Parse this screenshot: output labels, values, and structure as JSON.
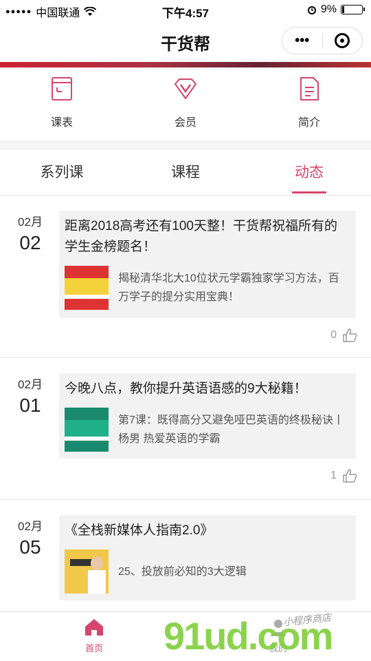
{
  "status_bar": {
    "signal": "●●●●●",
    "carrier": "中国联通",
    "wifi": "wifi-icon",
    "time": "下午4:57",
    "battery": "9%"
  },
  "nav": {
    "title": "干货帮",
    "more": "•••"
  },
  "quick_menu": [
    {
      "label": "课表",
      "icon": "schedule-icon"
    },
    {
      "label": "会员",
      "icon": "vip-icon"
    },
    {
      "label": "简介",
      "icon": "document-icon"
    }
  ],
  "tabs": [
    {
      "label": "系列课",
      "active": false
    },
    {
      "label": "课程",
      "active": false
    },
    {
      "label": "动态",
      "active": true
    }
  ],
  "posts": [
    {
      "month": "02月",
      "day": "02",
      "title": "距离2018高考还有100天整！干货帮祝福所有的学生金榜题名！",
      "attach_text": "揭秘清华北大10位状元学霸独家学习方法，百万学子的提分实用宝典！",
      "likes": "0"
    },
    {
      "month": "02月",
      "day": "01",
      "title": "今晚八点，教你提升英语语感的9大秘籍！",
      "attach_text": "第7课：既得高分又避免哑巴英语的终极秘诀丨杨男 热爱英语的学霸",
      "likes": "1"
    },
    {
      "month": "02月",
      "day": "05",
      "title": "《全栈新媒体人指南2.0》",
      "attach_text": "25、投放前必知的3大逻辑",
      "likes": ""
    }
  ],
  "tabbar": {
    "home": "首页",
    "mine": "我的"
  },
  "watermark": {
    "main": "91ud.com",
    "sub": "小程序商店"
  },
  "colors": {
    "accent": "#d6456b",
    "watermark": "#7fcf3a"
  }
}
